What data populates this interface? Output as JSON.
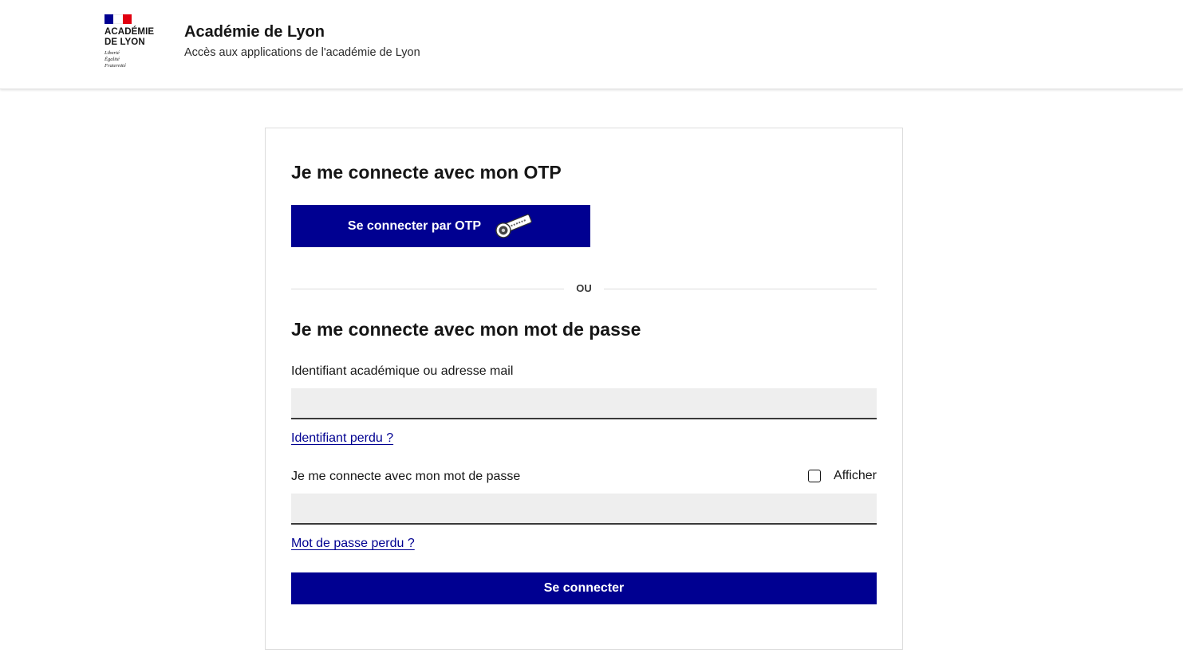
{
  "header": {
    "logo": {
      "name_line1": "ACADÉMIE",
      "name_line2": "DE LYON",
      "motto": [
        "Liberté",
        "Égalité",
        "Fraternité"
      ],
      "flag_colors": [
        "#000091",
        "#ffffff",
        "#e1000f"
      ]
    },
    "title": "Académie de Lyon",
    "tagline": "Accès aux applications de l'académie de Lyon"
  },
  "otp_section": {
    "heading": "Je me connecte avec mon OTP",
    "button_label": "Se connecter par OTP",
    "button_icon": "otp-key-icon"
  },
  "separator": {
    "label": "OU"
  },
  "password_section": {
    "heading": "Je me connecte avec mon mot de passe",
    "username_label": "Identifiant académique ou adresse mail",
    "username_value": "",
    "lost_username_link": "Identifiant perdu ?",
    "password_label": "Je me connecte avec mon mot de passe",
    "password_value": "",
    "show_password_label": "Afficher",
    "show_password_checked": false,
    "lost_password_link": "Mot de passe perdu ?",
    "submit_label": "Se connecter"
  },
  "colors": {
    "primary": "#000091",
    "input_bg": "#eeeeee",
    "text": "#161616"
  }
}
